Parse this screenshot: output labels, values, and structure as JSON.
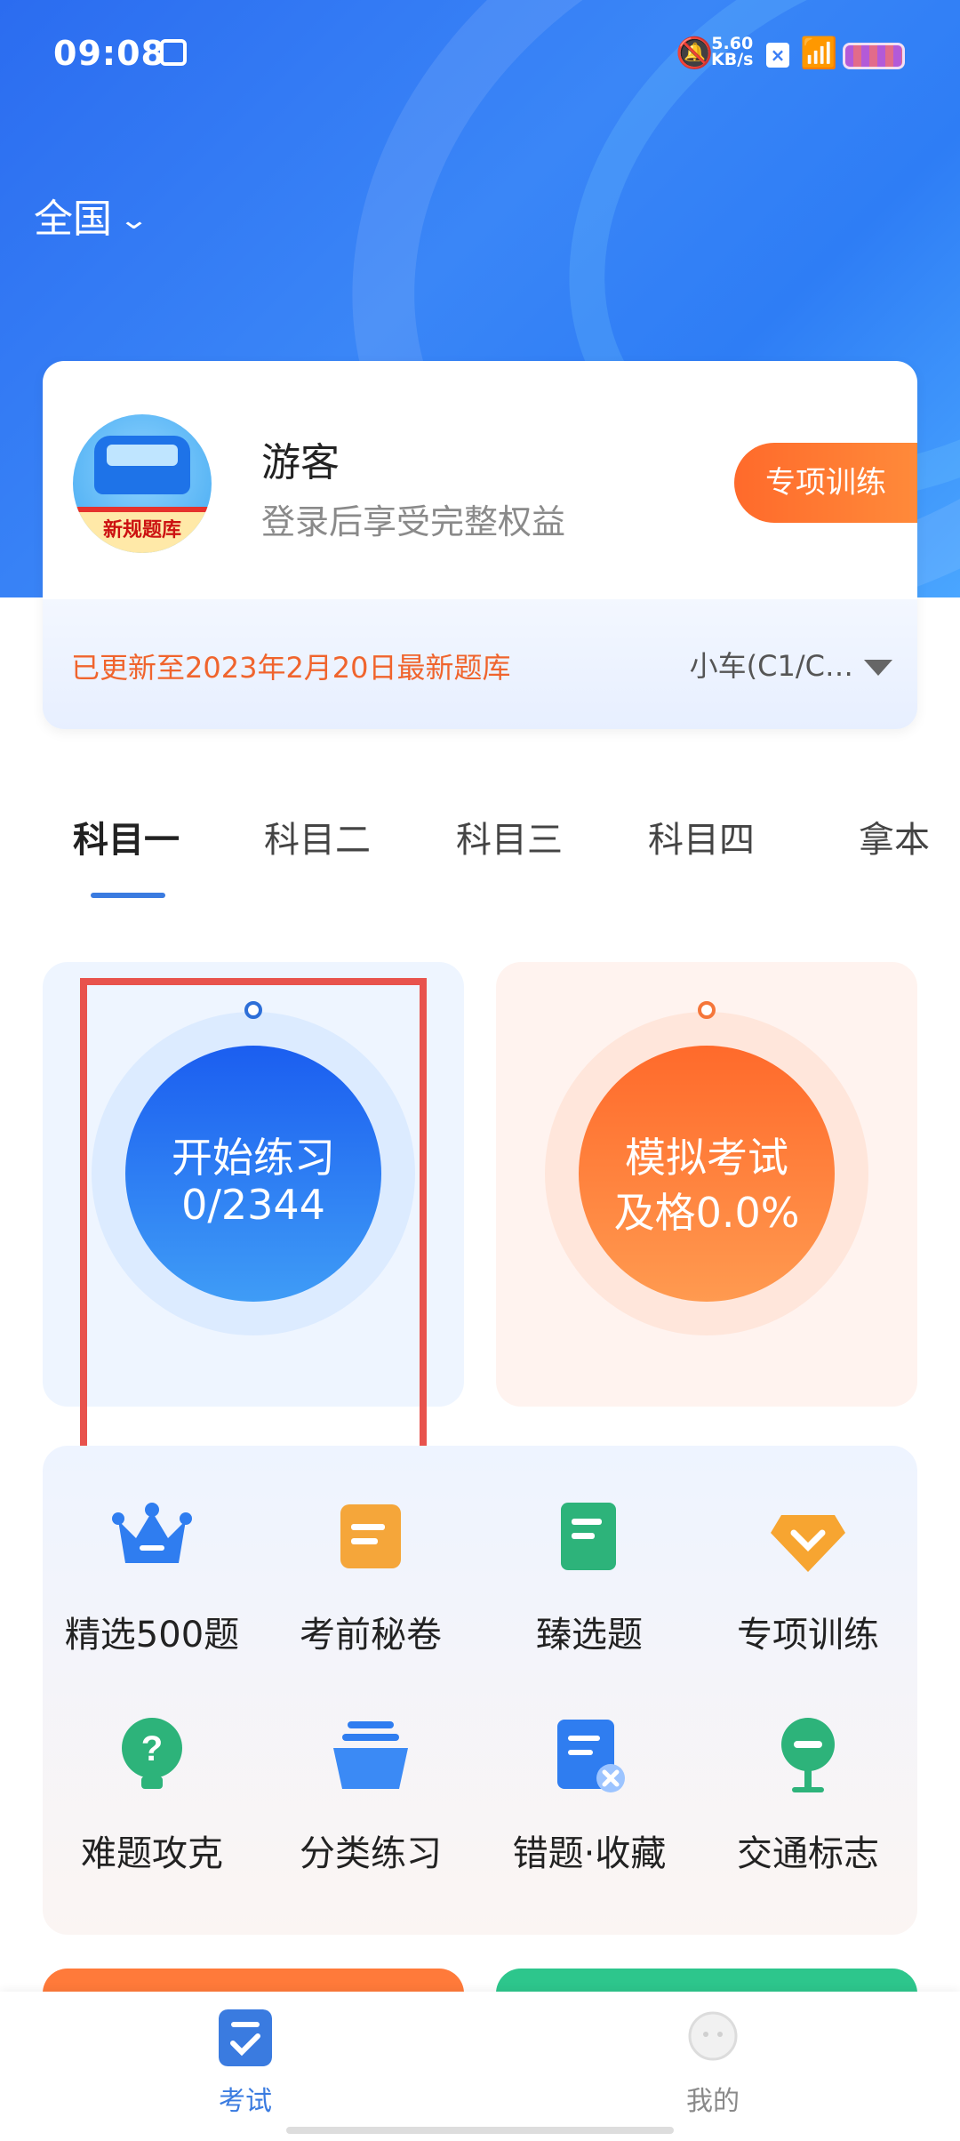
{
  "status": {
    "time": "09:08",
    "speed_top": "5.60",
    "speed_unit": "KB/s"
  },
  "region": {
    "label": "全国"
  },
  "user": {
    "name": "游客",
    "subtitle": "登录后享受完整权益",
    "avatar_badge": "新规题库",
    "special_button": "专项训练"
  },
  "bank": {
    "update_text": "已更新至2023年2月20日最新题库",
    "car_type": "小车(C1/C…"
  },
  "tabs": [
    "科目一",
    "科目二",
    "科目三",
    "科目四",
    "拿本"
  ],
  "practice": {
    "title": "开始练习",
    "progress": "0/2344"
  },
  "exam": {
    "title": "模拟考试",
    "pass_rate": "及格0.0%"
  },
  "grid": [
    {
      "label": "精选500题",
      "icon": "crown-icon"
    },
    {
      "label": "考前秘卷",
      "icon": "scroll-icon"
    },
    {
      "label": "臻选题",
      "icon": "book-icon"
    },
    {
      "label": "专项训练",
      "icon": "diamond-check-icon"
    },
    {
      "label": "难题攻克",
      "icon": "question-bulb-icon"
    },
    {
      "label": "分类练习",
      "icon": "stack-icon"
    },
    {
      "label": "错题·收藏",
      "icon": "doc-x-icon"
    },
    {
      "label": "交通标志",
      "icon": "sign-icon"
    }
  ],
  "nav": [
    {
      "label": "考试",
      "color": "#3a7be0"
    },
    {
      "label": "我的",
      "color": "#8a8a8a"
    }
  ]
}
